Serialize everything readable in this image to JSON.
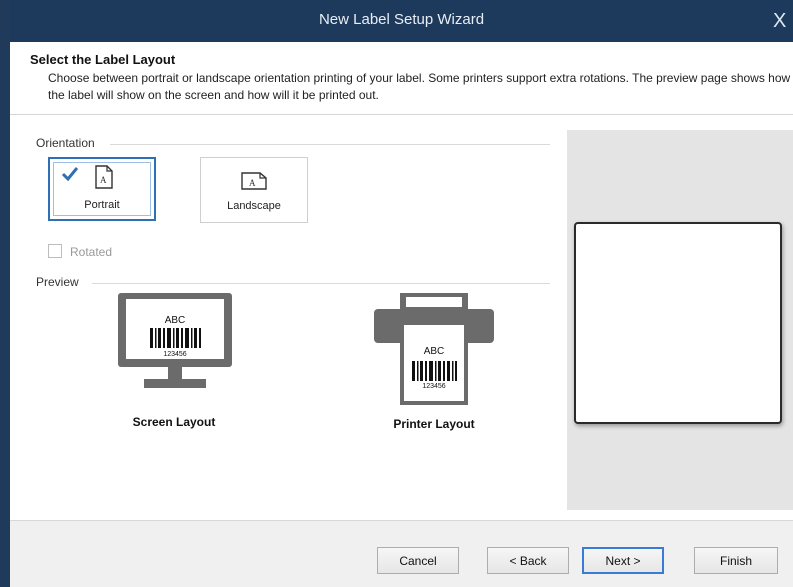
{
  "window": {
    "title": "New Label Setup Wizard",
    "close_glyph": "X"
  },
  "header": {
    "title": "Select the Label Layout",
    "description": "Choose between portrait or landscape orientation printing of your label. Some printers support extra rotations. The preview page shows how the label will show on the screen and how will it be printed out."
  },
  "orientation": {
    "group_label": "Orientation",
    "options": [
      {
        "label": "Portrait",
        "selected": true,
        "icon": "portrait-page-icon"
      },
      {
        "label": "Landscape",
        "selected": false,
        "icon": "landscape-page-icon"
      }
    ],
    "rotated_label": "Rotated",
    "rotated_checked": false,
    "rotated_enabled": false
  },
  "preview": {
    "group_label": "Preview",
    "screen": {
      "caption": "Screen Layout",
      "sample_text": "ABC",
      "sample_number": "123456",
      "icon": "monitor-icon"
    },
    "printer": {
      "caption": "Printer Layout",
      "sample_text": "ABC",
      "sample_number": "123456",
      "icon": "printer-icon"
    }
  },
  "buttons": {
    "cancel": "Cancel",
    "back": "< Back",
    "next": "Next >",
    "finish": "Finish"
  },
  "colors": {
    "titlebar": "#1d3a5c",
    "accent": "#2f6fb5",
    "icon_gray": "#666666"
  }
}
